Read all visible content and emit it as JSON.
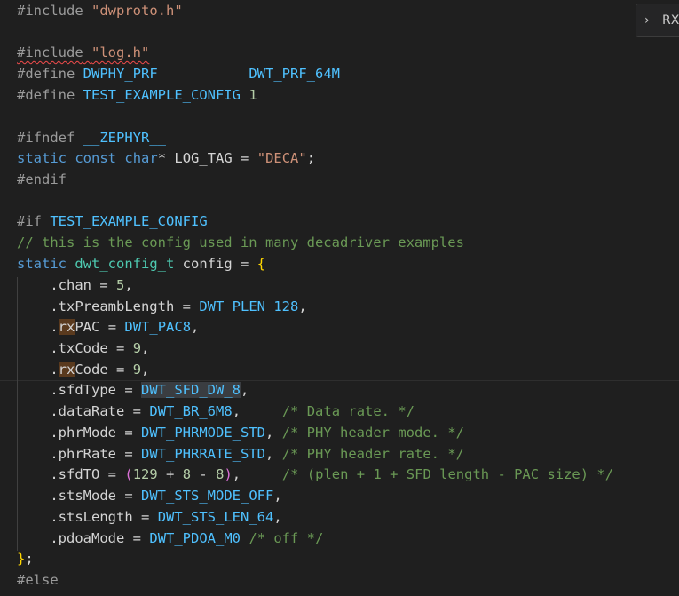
{
  "widget": {
    "chevron": "›",
    "label": "RX"
  },
  "code": {
    "l1": {
      "directive": "#include",
      "arg": "\"dwproto.h\""
    },
    "l3": {
      "directive": "#include",
      "arg": "\"log.h\""
    },
    "l4": {
      "directive": "#define",
      "name": "DWPHY_PRF",
      "value": "DWT_PRF_64M"
    },
    "l5": {
      "directive": "#define",
      "name": "TEST_EXAMPLE_CONFIG",
      "value": "1"
    },
    "l7": {
      "directive": "#ifndef",
      "name": "__ZEPHYR__"
    },
    "l8": {
      "kw1": "static",
      "kw2": "const",
      "kw3": "char",
      "ptr": "*",
      "name": "LOG_TAG",
      "eq": "=",
      "str": "\"DECA\"",
      "semi": ";"
    },
    "l9": {
      "directive": "#endif"
    },
    "l11": {
      "directive": "#if",
      "name": "TEST_EXAMPLE_CONFIG"
    },
    "l12": {
      "comment": "// this is the config used in many decadriver examples"
    },
    "l13": {
      "kw": "static",
      "type": "dwt_config_t",
      "name": "config",
      "eq": "=",
      "brace": "{"
    },
    "l14": {
      "field": ".chan",
      "eq": "=",
      "value": "5",
      "tail": ","
    },
    "l15": {
      "field": ".txPreambLength",
      "eq": "=",
      "value": "DWT_PLEN_128",
      "tail": ","
    },
    "l16": {
      "dot": ".",
      "hl": "rx",
      "rest": "PAC",
      "eq": "=",
      "value": "DWT_PAC8",
      "tail": ","
    },
    "l17": {
      "field": ".txCode",
      "eq": "=",
      "value": "9",
      "tail": ","
    },
    "l18": {
      "dot": ".",
      "hl": "rx",
      "rest": "Code",
      "eq": "=",
      "value": "9",
      "tail": ","
    },
    "l19": {
      "field": ".sfdType",
      "eq": "=",
      "value": "DWT_SFD_DW_8",
      "tail": ","
    },
    "l20": {
      "field": ".dataRate",
      "eq": "=",
      "value": "DWT_BR_6M8",
      "tail": ",",
      "comment": "/* Data rate. */"
    },
    "l21": {
      "field": ".phrMode",
      "eq": "=",
      "value": "DWT_PHRMODE_STD",
      "tail": ",",
      "comment": "/* PHY header mode. */"
    },
    "l22": {
      "field": ".phrRate",
      "eq": "=",
      "value": "DWT_PHRRATE_STD",
      "tail": ",",
      "comment": "/* PHY header rate. */"
    },
    "l23": {
      "field": ".sfdTO",
      "eq": "=",
      "open": "(",
      "a": "129",
      "plus": "+",
      "b": "8",
      "minus": "-",
      "c": "8",
      "close": ")",
      "tail": ",",
      "comment": "/* (plen + 1 + SFD length - PAC size) */"
    },
    "l24": {
      "field": ".stsMode",
      "eq": "=",
      "value": "DWT_STS_MODE_OFF",
      "tail": ","
    },
    "l25": {
      "field": ".stsLength",
      "eq": "=",
      "value": "DWT_STS_LEN_64",
      "tail": ","
    },
    "l26": {
      "field": ".pdoaMode",
      "eq": "=",
      "value": "DWT_PDOA_M0",
      "comment": "/* off */"
    },
    "l27": {
      "brace": "}",
      "semi": ";"
    },
    "l28": {
      "directive": "#else"
    }
  }
}
